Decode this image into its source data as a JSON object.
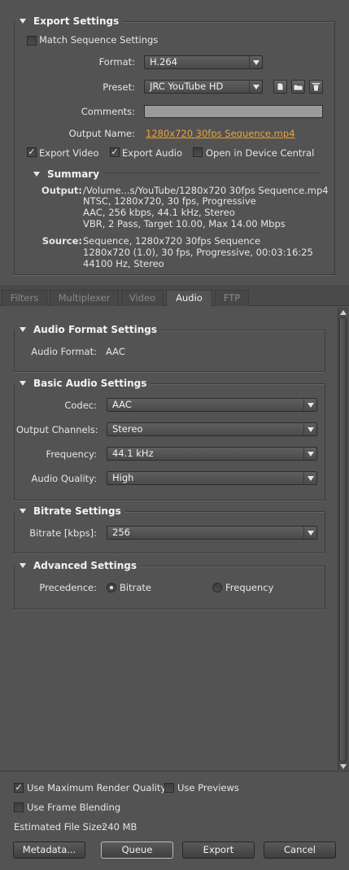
{
  "export_settings": {
    "title": "Export Settings",
    "match_sequence_label": "Match Sequence Settings",
    "match_sequence_checked": false,
    "format_label": "Format:",
    "format_value": "H.264",
    "preset_label": "Preset:",
    "preset_value": "JRC YouTube HD",
    "comments_label": "Comments:",
    "comments_value": "",
    "output_name_label": "Output Name:",
    "output_name_value": "1280x720 30fps Sequence.mp4",
    "export_video_label": "Export Video",
    "export_video_checked": true,
    "export_audio_label": "Export Audio",
    "export_audio_checked": true,
    "device_central_label": "Open in Device Central",
    "device_central_checked": false
  },
  "summary": {
    "title": "Summary",
    "output_label": "Output:",
    "output_lines": [
      "/Volume...s/YouTube/1280x720 30fps Sequence.mp4",
      "NTSC, 1280x720, 30 fps, Progressive",
      "AAC, 256 kbps, 44.1 kHz, Stereo",
      "VBR, 2 Pass, Target 10.00, Max 14.00 Mbps"
    ],
    "source_label": "Source:",
    "source_lines": [
      "Sequence, 1280x720 30fps Sequence",
      "1280x720 (1.0), 30 fps, Progressive, 00:03:16:25",
      "44100 Hz, Stereo"
    ]
  },
  "tabs": [
    {
      "label": "Filters",
      "active": false
    },
    {
      "label": "Multiplexer",
      "active": false
    },
    {
      "label": "Video",
      "active": false
    },
    {
      "label": "Audio",
      "active": true
    },
    {
      "label": "FTP",
      "active": false
    }
  ],
  "audio_format": {
    "title": "Audio Format Settings",
    "label": "Audio Format:",
    "value": "AAC"
  },
  "basic_audio": {
    "title": "Basic Audio Settings",
    "codec_label": "Codec:",
    "codec_value": "AAC",
    "channels_label": "Output Channels:",
    "channels_value": "Stereo",
    "frequency_label": "Frequency:",
    "frequency_value": "44.1 kHz",
    "quality_label": "Audio Quality:",
    "quality_value": "High"
  },
  "bitrate": {
    "title": "Bitrate Settings",
    "label": "Bitrate [kbps]:",
    "value": "256"
  },
  "advanced": {
    "title": "Advanced Settings",
    "precedence_label": "Precedence:",
    "bitrate_option": "Bitrate",
    "frequency_option": "Frequency",
    "selected": "Bitrate"
  },
  "footer": {
    "max_render_label": "Use Maximum Render Quality",
    "max_render_checked": true,
    "previews_label": "Use Previews",
    "previews_checked": false,
    "frame_blending_label": "Use Frame Blending",
    "frame_blending_checked": false,
    "file_size_label": "Estimated File Size:",
    "file_size_value": "240 MB",
    "metadata_button": "Metadata...",
    "queue_button": "Queue",
    "export_button": "Export",
    "cancel_button": "Cancel"
  },
  "colors": {
    "panel_bg": "#535353",
    "link": "#e8a33a",
    "border_dark": "#3a3a3a"
  }
}
